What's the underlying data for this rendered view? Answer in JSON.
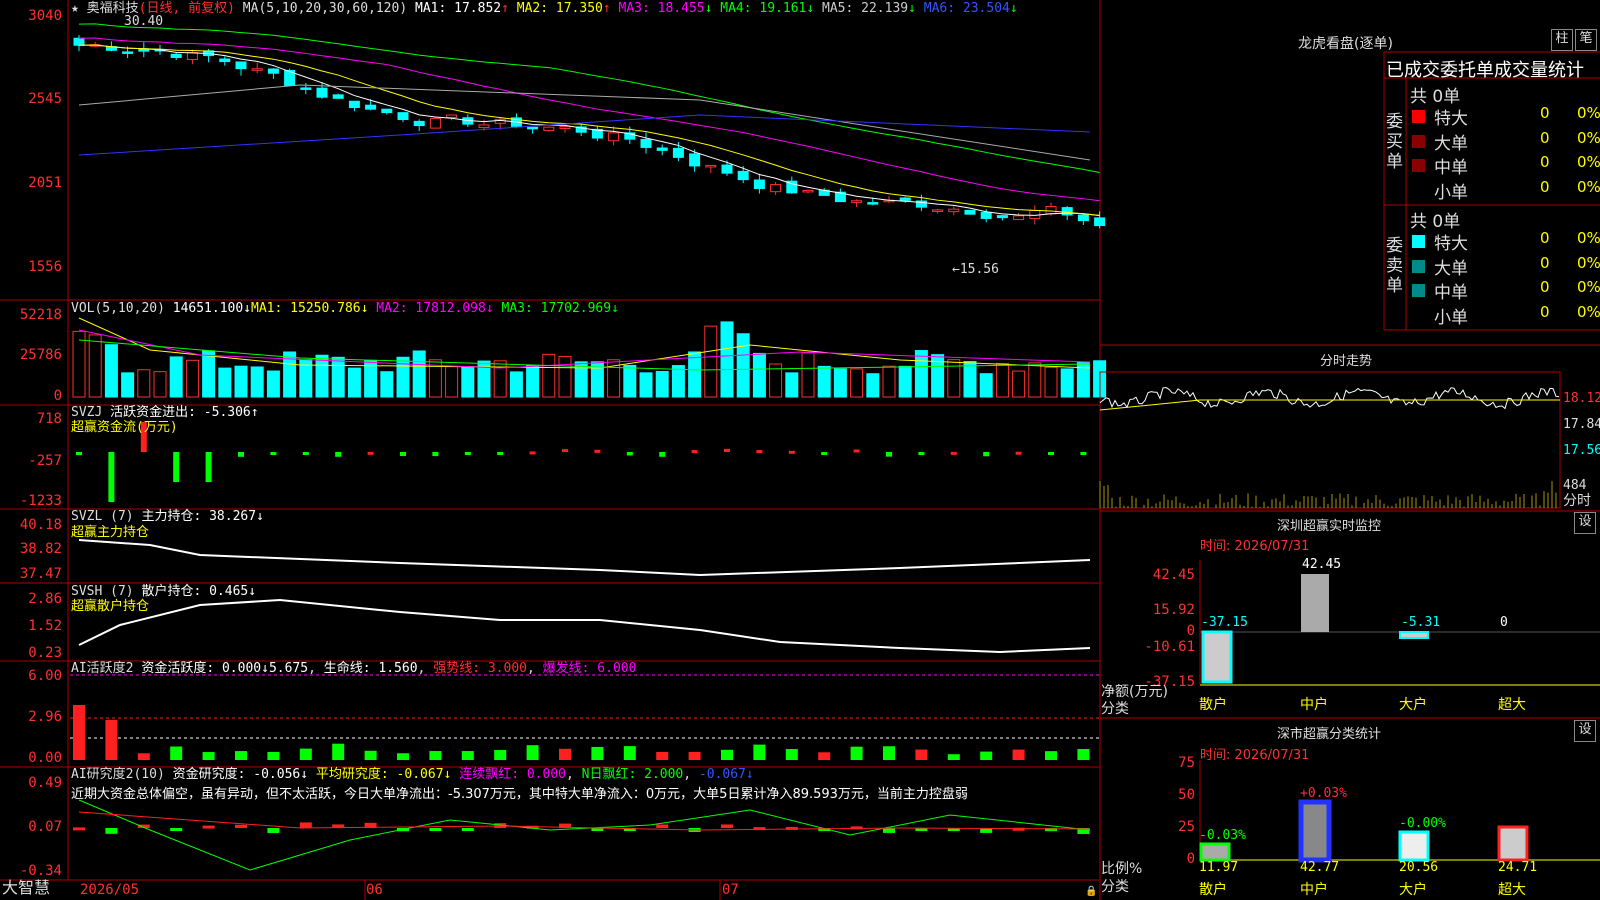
{
  "colors": {
    "up": "#ff3030",
    "down": "#00ffff",
    "ma1": "#ffffff",
    "ma2": "#ffff00",
    "ma3": "#ff00ff",
    "ma4": "#00ff00",
    "ma5": "#aaaaaa",
    "ma6": "#3333ff",
    "green": "#00ff00",
    "red": "#ff2020",
    "yellow": "#ffff00",
    "magenta": "#ff00ff"
  },
  "main": {
    "title": "★ 奥福科技",
    "mode": "(日线, 前复权)",
    "ma_params": "MA(5,10,20,30,60,120)",
    "ma": [
      {
        "label": "MA1: 17.852",
        "arrow": "↑"
      },
      {
        "label": "MA2: 17.350",
        "arrow": "↑"
      },
      {
        "label": "MA3: 18.455",
        "arrow": "↓"
      },
      {
        "label": "MA4: 19.161",
        "arrow": "↓"
      },
      {
        "label": "MA5: 22.139",
        "arrow": "↓"
      },
      {
        "label": "MA6: 23.504",
        "arrow": "↓"
      }
    ],
    "yticks": [
      "3040",
      "2545",
      "2051",
      "1556"
    ],
    "high_label": "30.40",
    "low_label": "←15.56"
  },
  "vol": {
    "name": "VOL(5,10,20)",
    "value": "14651.100↓",
    "ma1": "MA1: 15250.786↓",
    "ma2": "MA2: 17812.098↓",
    "ma3": "MA3: 17702.969↓",
    "yticks": [
      "52218",
      "25786",
      "0"
    ]
  },
  "svzj": {
    "name": "SVZJ",
    "desc": "活跃资金进出: -5.306↑",
    "sub": "超赢资金流(万元)",
    "yticks": [
      "718",
      "-257",
      "-1233"
    ]
  },
  "svzl": {
    "name": "SVZL  (7)",
    "desc": "主力持仓: 38.267↓",
    "sub": "超赢主力持仓",
    "yticks": [
      "40.18",
      "38.82",
      "37.47"
    ]
  },
  "svsh": {
    "name": "SVSH  (7)",
    "desc": "散户持仓: 0.465↓",
    "sub": "超赢散户持仓",
    "yticks": [
      "2.86",
      "1.52",
      "0.23"
    ]
  },
  "ai1": {
    "name": "AI活跃度2",
    "desc": "资金活跃度: 0.000↓",
    "v2": "5.675",
    "life": "生命线: 1.560",
    "strong": "强势线: 3.000",
    "burst": "爆发线: 6.000",
    "yticks": [
      "6.00",
      "2.96",
      "0.00"
    ]
  },
  "ai2": {
    "name": "AI研究度2(10)",
    "desc": "资金研究度: -0.056↓",
    "avg": "平均研究度: -0.067↓",
    "cont": "连续飘红: 0.000",
    "nday": "N日飘红: 2.000",
    "last": "-0.067↓",
    "yticks": [
      "0.49",
      "0.07",
      "-0.34"
    ],
    "comment": "近期大资金总体偏空，虽有异动，但不太活跃，今日大单净流出：-5.307万元，其中特大单净流入：0万元，大单5日累计净入89.593万元，当前主力控盘弱"
  },
  "xaxis": {
    "brand": "大智慧",
    "labels": [
      "2026/05",
      "06",
      "07"
    ]
  },
  "lhb": {
    "title": "龙虎看盘(逐单)",
    "btn1": "柱",
    "btn2": "笔",
    "header": "已成交委托单成交量统计",
    "buy": {
      "side": "委买单",
      "total": "共 0单",
      "rows": [
        {
          "name": "特大",
          "count": "0",
          "pct": "0%"
        },
        {
          "name": "大单",
          "count": "0",
          "pct": "0%"
        },
        {
          "name": "中单",
          "count": "0",
          "pct": "0%"
        },
        {
          "name": "小单",
          "count": "0",
          "pct": "0%"
        }
      ]
    },
    "sell": {
      "side": "委卖单",
      "total": "共 0单",
      "rows": [
        {
          "name": "特大",
          "count": "0",
          "pct": "0%"
        },
        {
          "name": "大单",
          "count": "0",
          "pct": "0%"
        },
        {
          "name": "中单",
          "count": "0",
          "pct": "0%"
        },
        {
          "name": "小单",
          "count": "0",
          "pct": "0%"
        }
      ]
    }
  },
  "fenshi": {
    "title": "分时走势",
    "y1": "18.12",
    "y2": "17.84",
    "y3": "17.56",
    "vol": "484",
    "label": "分时"
  },
  "sz_monitor": {
    "title": "深圳超赢实时监控",
    "btn": "设",
    "time": "时间: 2026/07/31",
    "yticks": [
      "42.45",
      "15.92",
      "0",
      "-10.61",
      "-37.15"
    ],
    "ylabel1": "净额(万元)",
    "ylabel2": "分类",
    "bars": [
      {
        "name": "散户",
        "value": "-37.15"
      },
      {
        "name": "中户",
        "value": "42.45"
      },
      {
        "name": "大户",
        "value": "-5.31"
      },
      {
        "name": "超大",
        "value": "0"
      }
    ]
  },
  "sz_stats": {
    "title": "深市超赢分类统计",
    "btn": "设",
    "time": "时间: 2026/07/31",
    "yticks": [
      "75",
      "50",
      "25",
      "0"
    ],
    "ylabel1": "比例%",
    "ylabel2": "分类",
    "bars": [
      {
        "name": "散户",
        "top": "-0.03%",
        "value": "11.97"
      },
      {
        "name": "中户",
        "top": "+0.03%",
        "value": "42.77"
      },
      {
        "name": "大户",
        "top": "-0.00%",
        "value": "20.56"
      },
      {
        "name": "超大",
        "top": "",
        "value": "24.71"
      }
    ]
  }
}
